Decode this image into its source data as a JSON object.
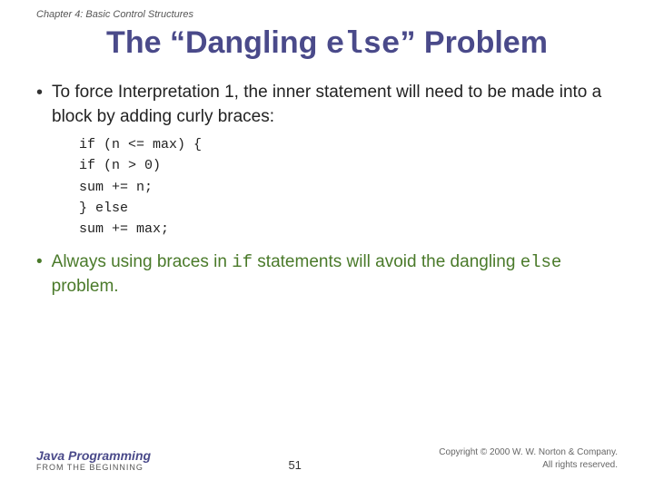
{
  "header": {
    "chapter": "Chapter 4: Basic Control Structures"
  },
  "title": {
    "part1": "The “Dangling ",
    "code": "else",
    "part2": "” Problem"
  },
  "bullets": [
    {
      "text": "To force Interpretation 1, the inner statement will need to be made into a block by adding curly braces:"
    },
    {
      "text_part1": "Always using braces in ",
      "code": "if",
      "text_part2": " statements will avoid the dangling ",
      "code2": "else",
      "text_part3": " problem."
    }
  ],
  "code_block": {
    "lines": [
      "if (n <= max) {",
      "  if (n > 0)",
      "    sum += n;",
      "} else",
      "  sum += max;"
    ]
  },
  "footer": {
    "brand_title": "Java Programming",
    "brand_subtitle": "FROM THE BEGINNING",
    "page_number": "51",
    "copyright": "Copyright © 2000 W. W. Norton & Company.\nAll rights reserved."
  }
}
